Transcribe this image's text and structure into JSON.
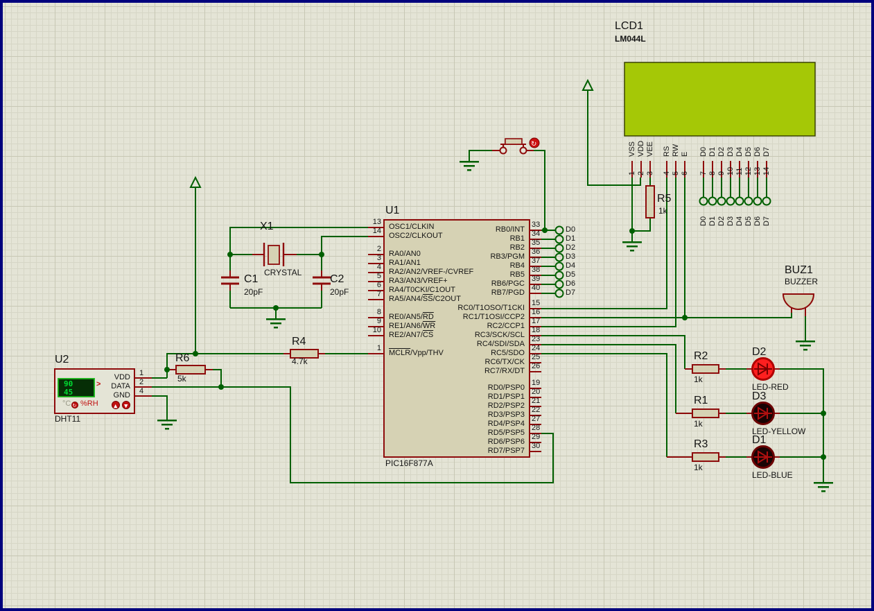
{
  "u1": {
    "ref": "U1",
    "model": "PIC16F877A",
    "left_pins": [
      {
        "n": "13",
        "pre": "OSC1/CLKIN"
      },
      {
        "n": "14",
        "pre": "OSC2/CLKOUT"
      },
      {
        "n": "2",
        "pre": "RA0/AN0"
      },
      {
        "n": "3",
        "pre": "RA1/AN1"
      },
      {
        "n": "4",
        "pre": "RA2/AN2/VREF-/CVREF"
      },
      {
        "n": "5",
        "pre": "RA3/AN3/VREF+"
      },
      {
        "n": "6",
        "pre": "RA4/T0CKI/C1OUT"
      },
      {
        "n": "7",
        "pre": "RA5/AN4/",
        "over": "SS",
        "post": "/C2OUT"
      },
      {
        "n": "8",
        "pre": "RE0/AN5/",
        "over": "RD",
        "post": ""
      },
      {
        "n": "9",
        "pre": "RE1/AN6/",
        "over": "WR",
        "post": ""
      },
      {
        "n": "10",
        "pre": "RE2/AN7/",
        "over": "CS",
        "post": ""
      },
      {
        "n": "1",
        "pre": "",
        "over": "MCLR",
        "post": "/Vpp/THV"
      }
    ],
    "right_pins": [
      {
        "n": "33",
        "label": "RB0/INT"
      },
      {
        "n": "34",
        "label": "RB1"
      },
      {
        "n": "35",
        "label": "RB2"
      },
      {
        "n": "36",
        "label": "RB3/PGM"
      },
      {
        "n": "37",
        "label": "RB4"
      },
      {
        "n": "38",
        "label": "RB5"
      },
      {
        "n": "39",
        "label": "RB6/PGC"
      },
      {
        "n": "40",
        "label": "RB7/PGD"
      },
      {
        "n": "15",
        "label": "RC0/T1OSO/T1CKI"
      },
      {
        "n": "16",
        "label": "RC1/T1OSI/CCP2"
      },
      {
        "n": "17",
        "label": "RC2/CCP1"
      },
      {
        "n": "18",
        "label": "RC3/SCK/SCL"
      },
      {
        "n": "23",
        "label": "RC4/SDI/SDA"
      },
      {
        "n": "24",
        "label": "RC5/SDO"
      },
      {
        "n": "25",
        "label": "RC6/TX/CK"
      },
      {
        "n": "26",
        "label": "RC7/RX/DT"
      },
      {
        "n": "19",
        "label": "RD0/PSP0"
      },
      {
        "n": "20",
        "label": "RD1/PSP1"
      },
      {
        "n": "21",
        "label": "RD2/PSP2"
      },
      {
        "n": "22",
        "label": "RD3/PSP3"
      },
      {
        "n": "27",
        "label": "RD4/PSP4"
      },
      {
        "n": "28",
        "label": "RD5/PSP5"
      },
      {
        "n": "29",
        "label": "RD6/PSP6"
      },
      {
        "n": "30",
        "label": "RD7/PSP7"
      }
    ]
  },
  "u2": {
    "ref": "U2",
    "model": "DHT11",
    "pins": [
      {
        "n": "1",
        "name": "VDD"
      },
      {
        "n": "2",
        "name": "DATA"
      },
      {
        "n": "4",
        "name": "GND"
      }
    ],
    "display": {
      "line1": "90",
      "line2": "45",
      "cursor": ">",
      "unit_temp": "°C",
      "unit_hum": "%RH"
    }
  },
  "lcd": {
    "ref": "LCD1",
    "model": "LM044L",
    "pins": [
      {
        "n": "1",
        "name": "VSS"
      },
      {
        "n": "2",
        "name": "VDD"
      },
      {
        "n": "3",
        "name": "VEE"
      },
      {
        "n": "4",
        "name": "RS"
      },
      {
        "n": "5",
        "name": "RW"
      },
      {
        "n": "6",
        "name": "E"
      },
      {
        "n": "7",
        "name": "D0"
      },
      {
        "n": "8",
        "name": "D1"
      },
      {
        "n": "9",
        "name": "D2"
      },
      {
        "n": "10",
        "name": "D3"
      },
      {
        "n": "11",
        "name": "D4"
      },
      {
        "n": "12",
        "name": "D5"
      },
      {
        "n": "13",
        "name": "D6"
      },
      {
        "n": "14",
        "name": "D7"
      }
    ],
    "bus_terminals": [
      "D0",
      "D1",
      "D2",
      "D3",
      "D4",
      "D5",
      "D6",
      "D7"
    ]
  },
  "rb_terminals": [
    "D0",
    "D1",
    "D2",
    "D3",
    "D4",
    "D5",
    "D6",
    "D7"
  ],
  "x1": {
    "ref": "X1",
    "model": "CRYSTAL"
  },
  "c1": {
    "ref": "C1",
    "value": "20pF"
  },
  "c2": {
    "ref": "C2",
    "value": "20pF"
  },
  "r1": {
    "ref": "R1",
    "value": "1k"
  },
  "r2": {
    "ref": "R2",
    "value": "1k"
  },
  "r3": {
    "ref": "R3",
    "value": "1k"
  },
  "r4": {
    "ref": "R4",
    "value": "4.7k"
  },
  "r5": {
    "ref": "R5",
    "value": "1k"
  },
  "r6": {
    "ref": "R6",
    "value": "5k"
  },
  "buz1": {
    "ref": "BUZ1",
    "model": "BUZZER"
  },
  "led_d2": {
    "ref": "D2",
    "model": "LED-RED",
    "state": "on"
  },
  "led_d3": {
    "ref": "D3",
    "model": "LED-YELLOW",
    "state": "off"
  },
  "led_d1": {
    "ref": "D1",
    "model": "LED-BLUE",
    "state": "off"
  },
  "icons": {
    "button_actuator": "↻",
    "dht_adjust": "↻",
    "adjust_up": "▲",
    "adjust_down": "▼"
  },
  "colors": {
    "wire_green": "#005f00",
    "pin_red": "#8e0b0b",
    "body_fill": "#d6d2b4",
    "lcd_screen": "#a5c806",
    "led_on_fill": "#ff1f1f",
    "led_off_fill": "#190404",
    "sheet_border": "#00007d",
    "display_green": "#00dd33"
  }
}
